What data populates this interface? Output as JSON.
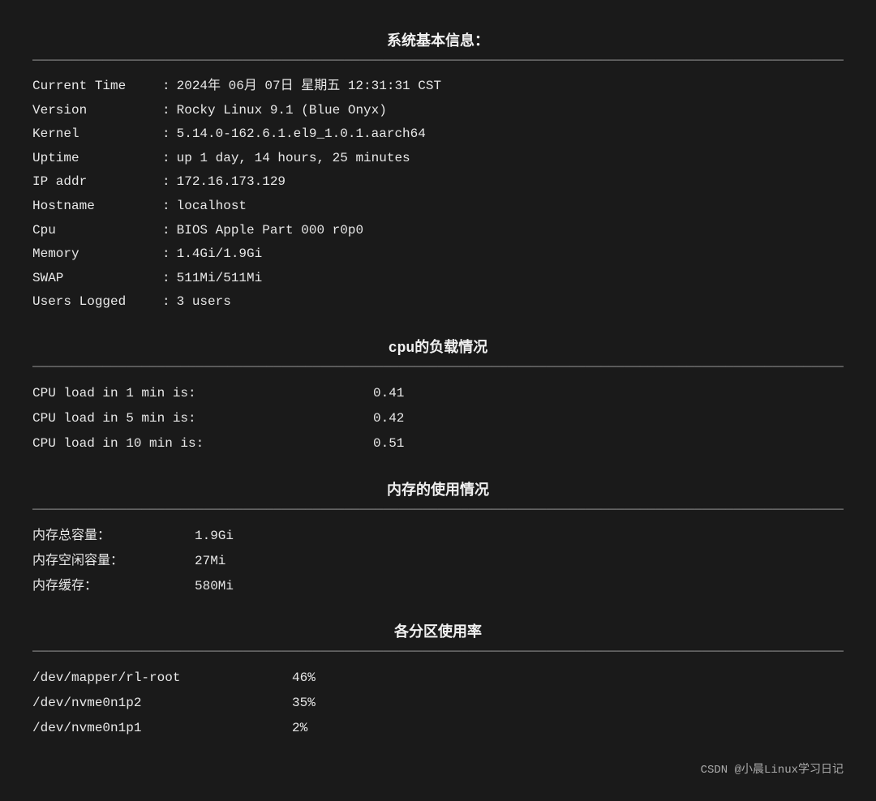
{
  "page": {
    "title": "系统基本信息：",
    "divider": "────────────────────────────────────────────────────────────────────────",
    "sysinfo": {
      "label": "系统基本信息：",
      "rows": [
        {
          "label": "Current Time",
          "colon": ":",
          "value": "2024年  06月  07日  星期五  12:31:31 CST"
        },
        {
          "label": "Version     ",
          "colon": ":",
          "value": "Rocky Linux 9.1 (Blue Onyx)"
        },
        {
          "label": "Kernel      ",
          "colon": ":",
          "value": "5.14.0-162.6.1.el9_1.0.1.aarch64"
        },
        {
          "label": "Uptime      ",
          "colon": ":",
          "value": "up 1 day, 14 hours, 25 minutes"
        },
        {
          "label": "IP addr     ",
          "colon": ":",
          "value": "172.16.173.129"
        },
        {
          "label": "Hostname    ",
          "colon": ":",
          "value": "localhost"
        },
        {
          "label": "Cpu         ",
          "colon": ":",
          "value": "BIOS Apple Part 000 r0p0"
        },
        {
          "label": "Memory      ",
          "colon": ":",
          "value": "1.4Gi/1.9Gi"
        },
        {
          "label": "SWAP        ",
          "colon": ":",
          "value": "511Mi/511Mi"
        },
        {
          "label": "Users Logged",
          "colon": ":",
          "value": "3 users"
        }
      ]
    },
    "cpu": {
      "title": "cpu的负载情况",
      "rows": [
        {
          "label": "CPU  load in  1  min is:",
          "value": "0.41"
        },
        {
          "label": "CPU  load in  5  min is:",
          "value": "0.42"
        },
        {
          "label": "CPU  load in 10  min is:",
          "value": "0.51"
        }
      ]
    },
    "memory": {
      "title": "内存的使用情况",
      "rows": [
        {
          "label": "内存总容量：",
          "value": "1.9Gi"
        },
        {
          "label": "内存空闲容量：",
          "value": "  27Mi"
        },
        {
          "label": "内存缓存：",
          "value": "580Mi"
        }
      ]
    },
    "disk": {
      "title": "各分区使用率",
      "rows": [
        {
          "label": "/dev/mapper/rl-root",
          "value": "46%"
        },
        {
          "label": "/dev/nvme0n1p2",
          "value": "35%"
        },
        {
          "label": "/dev/nvme0n1p1",
          "value": " 2%"
        }
      ]
    },
    "footer": {
      "text": "CSDN @小晨Linux学习日记"
    }
  }
}
